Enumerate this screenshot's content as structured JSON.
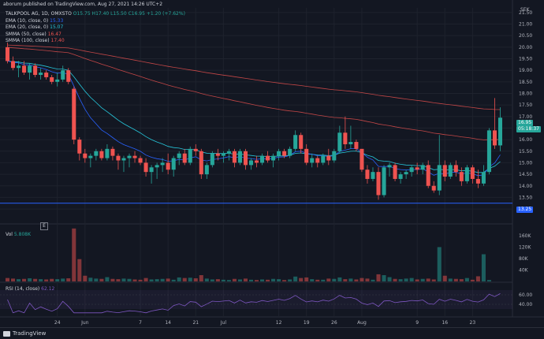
{
  "header": {
    "publisher": "aborum published on TradingView.com, Aug 27, 2021 14:26 UTC+2"
  },
  "legend": {
    "symbol": "TALKPOOL AG, 1D, OMXSTO",
    "ohlc": "O15.75 H17.40 L15.50 C16.95 +1.20 (+7.62%)",
    "ema10": {
      "label": "EMA (10, close, 0)",
      "value": "15.33"
    },
    "ema20": {
      "label": "EMA (20, close, 0)",
      "value": "15.07"
    },
    "smma50": {
      "label": "SMMA (50, close)",
      "value": "16.47"
    },
    "smma100": {
      "label": "SMMA (100, close)",
      "value": "17.40"
    }
  },
  "price_scale": {
    "currency": "SEK",
    "ticks": [
      "21.50",
      "21.00",
      "20.50",
      "20.00",
      "19.50",
      "19.00",
      "18.50",
      "18.00",
      "17.50",
      "17.00",
      "16.50",
      "16.00",
      "15.50",
      "15.00",
      "14.50",
      "14.00",
      "13.50",
      "13.00"
    ],
    "last_price": "16.95",
    "countdown": "05:18:37",
    "hline_label": "13.25"
  },
  "volume": {
    "label": "Vol",
    "value": "5.808K",
    "ticks": [
      "160K",
      "120K",
      "80K",
      "40K"
    ]
  },
  "rsi": {
    "label": "RSI (14, close)",
    "value": "62.12",
    "ticks": [
      "60.00",
      "40.00"
    ]
  },
  "time_axis": [
    "24",
    "Jun",
    "7",
    "14",
    "21",
    "Jul",
    "12",
    "19",
    "26",
    "Aug",
    "9",
    "16",
    "23"
  ],
  "misc": {
    "marker": "E",
    "logo": "TradingView"
  },
  "colors": {
    "up": "#26a69a",
    "down": "#ef5350",
    "ema10": "#2962ff",
    "ema20": "#26c6da",
    "smma": "#ef5350",
    "rsi": "#7e57c2",
    "hline": "#2962ff"
  },
  "chart_data": {
    "type": "candlestick",
    "ylim": [
      12.9,
      21.7
    ],
    "candles": [
      [
        20.0,
        20.2,
        19.3,
        19.4
      ],
      [
        19.4,
        19.6,
        19.0,
        19.1
      ],
      [
        19.1,
        19.4,
        18.7,
        19.2
      ],
      [
        19.2,
        19.4,
        18.8,
        18.9
      ],
      [
        18.9,
        19.3,
        18.6,
        19.2
      ],
      [
        19.2,
        19.3,
        18.7,
        18.8
      ],
      [
        18.8,
        19.1,
        18.6,
        18.9
      ],
      [
        18.9,
        19.0,
        18.6,
        18.7
      ],
      [
        18.7,
        18.8,
        18.4,
        18.5
      ],
      [
        18.5,
        18.9,
        18.3,
        18.6
      ],
      [
        18.6,
        19.2,
        18.5,
        19.0
      ],
      [
        19.0,
        19.1,
        18.4,
        18.5
      ],
      [
        18.2,
        18.3,
        15.8,
        16.0
      ],
      [
        16.0,
        16.1,
        15.1,
        15.4
      ],
      [
        15.4,
        15.6,
        15.0,
        15.2
      ],
      [
        15.2,
        15.4,
        14.8,
        15.3
      ],
      [
        15.3,
        15.6,
        15.1,
        15.5
      ],
      [
        15.5,
        15.6,
        15.1,
        15.2
      ],
      [
        15.2,
        15.8,
        15.1,
        15.6
      ],
      [
        15.6,
        15.7,
        15.1,
        15.3
      ],
      [
        15.3,
        15.4,
        14.7,
        15.1
      ],
      [
        15.1,
        15.3,
        14.6,
        15.2
      ],
      [
        15.2,
        15.4,
        14.8,
        15.3
      ],
      [
        15.3,
        15.5,
        15.0,
        15.2
      ],
      [
        15.2,
        15.3,
        14.9,
        15.0
      ],
      [
        15.0,
        15.2,
        14.4,
        14.6
      ],
      [
        14.6,
        14.9,
        14.1,
        14.8
      ],
      [
        14.8,
        15.0,
        14.3,
        14.9
      ],
      [
        14.9,
        15.2,
        14.6,
        15.0
      ],
      [
        15.0,
        15.4,
        14.5,
        14.7
      ],
      [
        14.7,
        15.3,
        14.4,
        15.2
      ],
      [
        15.2,
        15.5,
        14.9,
        15.4
      ],
      [
        15.4,
        15.6,
        14.9,
        15.0
      ],
      [
        15.0,
        15.7,
        14.9,
        15.6
      ],
      [
        15.6,
        15.8,
        15.3,
        15.5
      ],
      [
        15.5,
        15.6,
        14.3,
        14.5
      ],
      [
        14.5,
        15.0,
        14.3,
        14.9
      ],
      [
        14.9,
        15.5,
        14.8,
        15.4
      ],
      [
        15.4,
        15.6,
        15.1,
        15.3
      ],
      [
        15.3,
        15.5,
        15.0,
        15.4
      ],
      [
        15.4,
        15.6,
        15.1,
        15.5
      ],
      [
        15.5,
        15.6,
        14.8,
        15.0
      ],
      [
        15.0,
        15.6,
        14.9,
        15.5
      ],
      [
        15.5,
        15.6,
        14.7,
        14.9
      ],
      [
        14.9,
        15.2,
        14.7,
        15.1
      ],
      [
        15.1,
        15.3,
        14.8,
        15.0
      ],
      [
        15.0,
        15.4,
        14.9,
        15.3
      ],
      [
        15.3,
        15.5,
        15.0,
        15.1
      ],
      [
        15.1,
        15.4,
        14.8,
        15.3
      ],
      [
        15.3,
        15.6,
        15.1,
        15.5
      ],
      [
        15.5,
        15.6,
        15.2,
        15.3
      ],
      [
        15.3,
        15.7,
        15.2,
        15.6
      ],
      [
        15.6,
        16.4,
        15.5,
        16.2
      ],
      [
        16.2,
        16.3,
        15.4,
        15.6
      ],
      [
        15.6,
        15.8,
        14.9,
        15.0
      ],
      [
        15.0,
        15.4,
        14.8,
        15.2
      ],
      [
        15.2,
        15.3,
        14.8,
        15.0
      ],
      [
        15.0,
        15.4,
        14.9,
        15.3
      ],
      [
        15.3,
        15.6,
        14.9,
        15.1
      ],
      [
        15.1,
        15.6,
        15.0,
        15.5
      ],
      [
        15.5,
        16.6,
        15.4,
        16.3
      ],
      [
        16.3,
        17.0,
        15.6,
        15.8
      ],
      [
        15.8,
        16.6,
        15.6,
        15.9
      ],
      [
        15.9,
        16.0,
        15.5,
        15.6
      ],
      [
        15.6,
        15.6,
        14.6,
        14.7
      ],
      [
        14.7,
        14.9,
        14.1,
        14.3
      ],
      [
        14.3,
        14.8,
        14.2,
        14.6
      ],
      [
        14.6,
        14.8,
        13.4,
        13.6
      ],
      [
        13.6,
        14.9,
        13.5,
        14.8
      ],
      [
        14.8,
        15.0,
        14.4,
        14.9
      ],
      [
        14.9,
        15.0,
        14.2,
        14.3
      ],
      [
        14.3,
        14.6,
        14.1,
        14.5
      ],
      [
        14.5,
        14.7,
        14.3,
        14.6
      ],
      [
        14.6,
        14.9,
        14.4,
        14.8
      ],
      [
        14.8,
        15.0,
        14.5,
        14.7
      ],
      [
        14.7,
        15.0,
        14.5,
        14.9
      ],
      [
        14.9,
        15.1,
        13.9,
        14.0
      ],
      [
        14.0,
        14.2,
        13.7,
        13.8
      ],
      [
        13.8,
        16.2,
        13.6,
        14.9
      ],
      [
        14.9,
        15.1,
        14.2,
        14.4
      ],
      [
        14.4,
        15.0,
        14.3,
        14.9
      ],
      [
        14.9,
        15.1,
        14.4,
        14.6
      ],
      [
        14.6,
        14.8,
        14.0,
        14.2
      ],
      [
        14.2,
        14.9,
        14.1,
        14.8
      ],
      [
        14.8,
        14.9,
        14.1,
        14.3
      ],
      [
        14.3,
        14.7,
        13.9,
        14.1
      ],
      [
        14.1,
        14.9,
        14.0,
        14.6
      ],
      [
        14.6,
        16.5,
        14.5,
        16.4
      ],
      [
        16.4,
        17.8,
        15.6,
        15.75
      ],
      [
        15.75,
        17.4,
        15.5,
        16.95
      ]
    ],
    "volume": [
      12,
      10,
      8,
      9,
      11,
      9,
      8,
      7,
      9,
      8,
      10,
      11,
      185,
      78,
      20,
      13,
      10,
      9,
      15,
      9,
      8,
      10,
      9,
      7,
      6,
      12,
      7,
      8,
      9,
      10,
      6,
      14,
      12,
      13,
      11,
      22,
      10,
      7,
      8,
      6,
      5,
      9,
      7,
      10,
      6,
      5,
      7,
      6,
      9,
      8,
      5,
      7,
      17,
      12,
      14,
      8,
      6,
      6,
      10,
      9,
      14,
      8,
      10,
      7,
      12,
      10,
      6,
      25,
      22,
      15,
      9,
      8,
      10,
      12,
      7,
      9,
      10,
      7,
      120,
      20,
      10,
      9,
      8,
      12,
      6,
      18,
      95,
      5
    ]
  }
}
